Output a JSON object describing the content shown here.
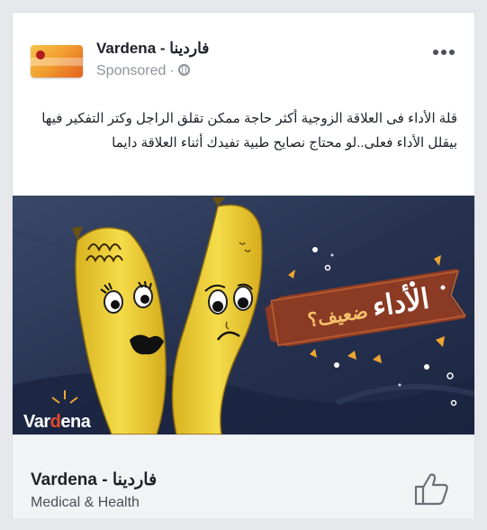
{
  "post": {
    "page_name": "Vardena - فاردينا",
    "sponsored_label": "Sponsored",
    "sponsored_separator": "·",
    "body_text": "قلة الأداء فى العلاقة الزوجية أكثر حاجة ممكن تقلق الراجل وكتر التفكير فيها بيقلل الأداء فعلى..لو محتاج نصايح طبية تفيدك أثناء العلاقة دايما"
  },
  "ad_image": {
    "badge_main": "الأداء",
    "badge_sub": "ضعيف؟",
    "brand_prefix": "Var",
    "brand_accent": "d",
    "brand_suffix": "ena"
  },
  "footer": {
    "title": "Vardena - فاردينا",
    "category": "Medical & Health"
  },
  "icons": {
    "more": "more-options-icon",
    "audience": "globe-icon",
    "like": "thumbs-up-icon"
  },
  "colors": {
    "banner": "#8b3a24",
    "banana": "#f1d23a",
    "background": "#2a3552",
    "brand_accent": "#e14a2d"
  }
}
